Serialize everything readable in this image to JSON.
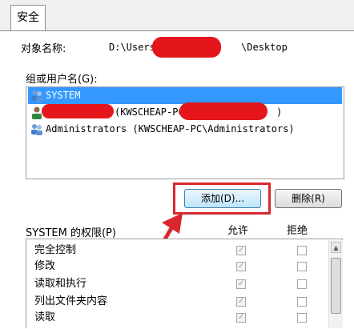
{
  "tab": {
    "label": "安全"
  },
  "object": {
    "label": "对象名称:",
    "path_start": "D:\\Users\\",
    "path_end": "\\Desktop"
  },
  "groups": {
    "label": "组或用户名(G):",
    "items": [
      {
        "name": "SYSTEM",
        "selected": true
      },
      {
        "name": "(KWSCHEAP-PC\\",
        "suffix": ")",
        "selected": false
      },
      {
        "name": "Administrators (KWSCHEAP-PC\\Administrators)",
        "selected": false
      }
    ]
  },
  "buttons": {
    "add": "添加(D)...",
    "remove": "删除(R)"
  },
  "permissions": {
    "label": "SYSTEM 的权限(P)",
    "allow_header": "允许",
    "deny_header": "拒绝",
    "rows": [
      {
        "name": "完全控制",
        "allow": true,
        "deny": false
      },
      {
        "name": "修改",
        "allow": true,
        "deny": false
      },
      {
        "name": "读取和执行",
        "allow": true,
        "deny": false
      },
      {
        "name": "列出文件夹内容",
        "allow": true,
        "deny": false
      },
      {
        "name": "读取",
        "allow": true,
        "deny": false
      }
    ]
  },
  "colors": {
    "selection": "#3399ff",
    "highlight": "#d9272d",
    "redaction": "#e4161c"
  }
}
